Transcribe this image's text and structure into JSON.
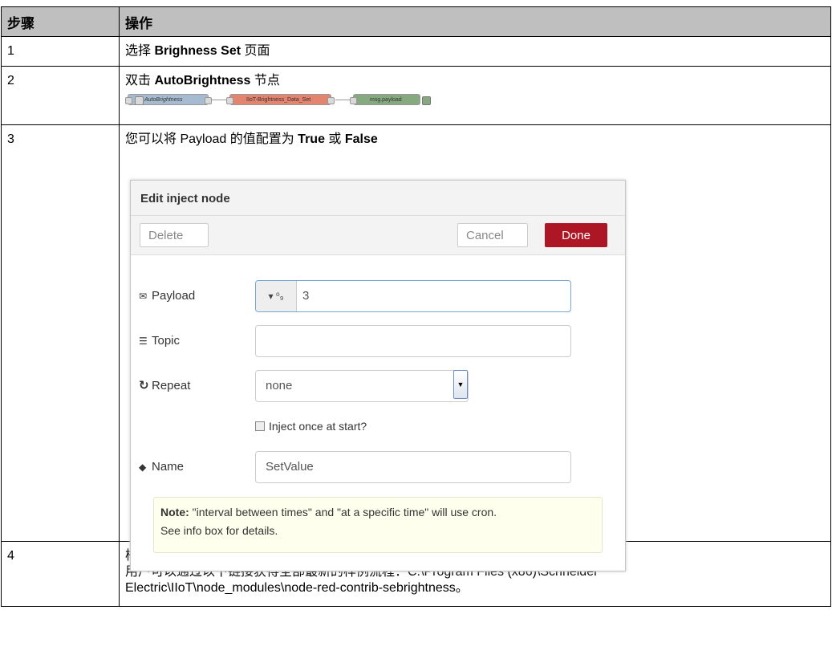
{
  "table": {
    "headers": [
      "步骤",
      "操作"
    ],
    "rows": [
      {
        "step": "1",
        "pre": "选择 ",
        "bold": "Brighness Set",
        "post": " 页面"
      },
      {
        "step": "2",
        "pre": "双击 ",
        "bold": "AutoBrightness",
        "post": " 节点"
      },
      {
        "step": "3",
        "pre": "您可以将 Payload 的值配置为 ",
        "bold": "True",
        "mid": " 或 ",
        "bold2": "False"
      },
      {
        "step": "4",
        "line1": "样例流程参考。",
        "line2": "用户可以通过以下链接获得全部最新的样例流程：C:\\Program Files (x86)\\Schneider",
        "line3": "Electric\\IIoT\\node_modules\\node-red-contrib-sebrightness。"
      }
    ]
  },
  "flow": {
    "node1": "AutoBrightness",
    "node2": "IIoT-Brightness_Data_Set",
    "node3": "msg.payload",
    "colors": {
      "inject": "#a6bbcf",
      "function": "#e2846e",
      "debug": "#87a980"
    }
  },
  "dialog": {
    "title": "Edit inject node",
    "delete_label": "Delete",
    "cancel_label": "Cancel",
    "done_label": "Done",
    "payload_label": "Payload",
    "payload_type": "⁰₉",
    "payload_value": "3",
    "topic_label": "Topic",
    "topic_value": "",
    "repeat_label": "Repeat",
    "repeat_value": "none",
    "inject_once_label": "Inject once at start?",
    "inject_once_checked": false,
    "name_label": "Name",
    "name_value": "SetValue",
    "note_bold": "Note:",
    "note_text": " \"interval between times\" and \"at a specific time\" will use cron.",
    "note_line2": "See info box for details."
  }
}
